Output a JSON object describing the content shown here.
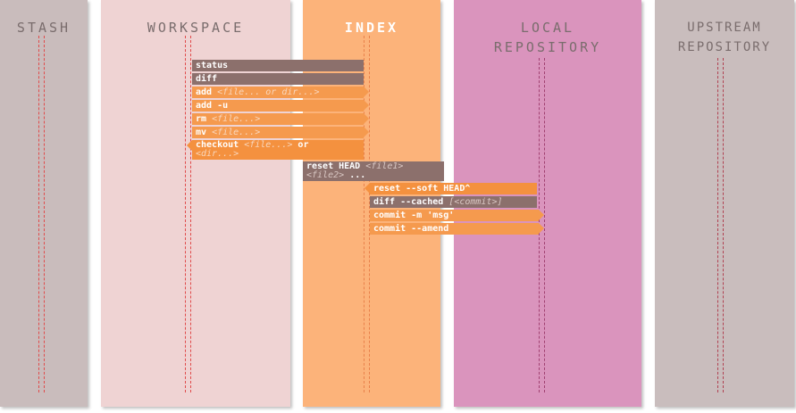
{
  "columns": [
    {
      "title": "STASH",
      "color": "#c9bcbc"
    },
    {
      "title": "WORKSPACE",
      "color": "#efd3d3"
    },
    {
      "title": "INDEX",
      "color": "#fcb37a"
    },
    {
      "title": "LOCAL REPOSITORY",
      "color": "#da94bd"
    },
    {
      "title": "UPSTREAM REPOSITORY",
      "color": "#c9bdbd"
    }
  ],
  "commands": {
    "status": "status",
    "diff": "diff",
    "add": "add",
    "add_arg": "<file... or dir...>",
    "add_u": "add -u",
    "rm": "rm",
    "rm_arg": "<file...>",
    "mv": "mv",
    "mv_arg": "<file...>",
    "checkout": "checkout",
    "checkout_arg": "<file...>",
    "checkout_or": "or",
    "checkout_arg2": "<dir...>",
    "reset_head": "reset HEAD",
    "reset_arg1": "<file1>",
    "reset_arg2": "<file2>",
    "reset_dots": "...",
    "reset_soft": "reset --soft HEAD^",
    "diff_cached": "diff --cached",
    "diff_cached_arg": "[<commit>]",
    "commit_m": "commit -m 'msg'",
    "commit_amend": "commit --amend"
  }
}
